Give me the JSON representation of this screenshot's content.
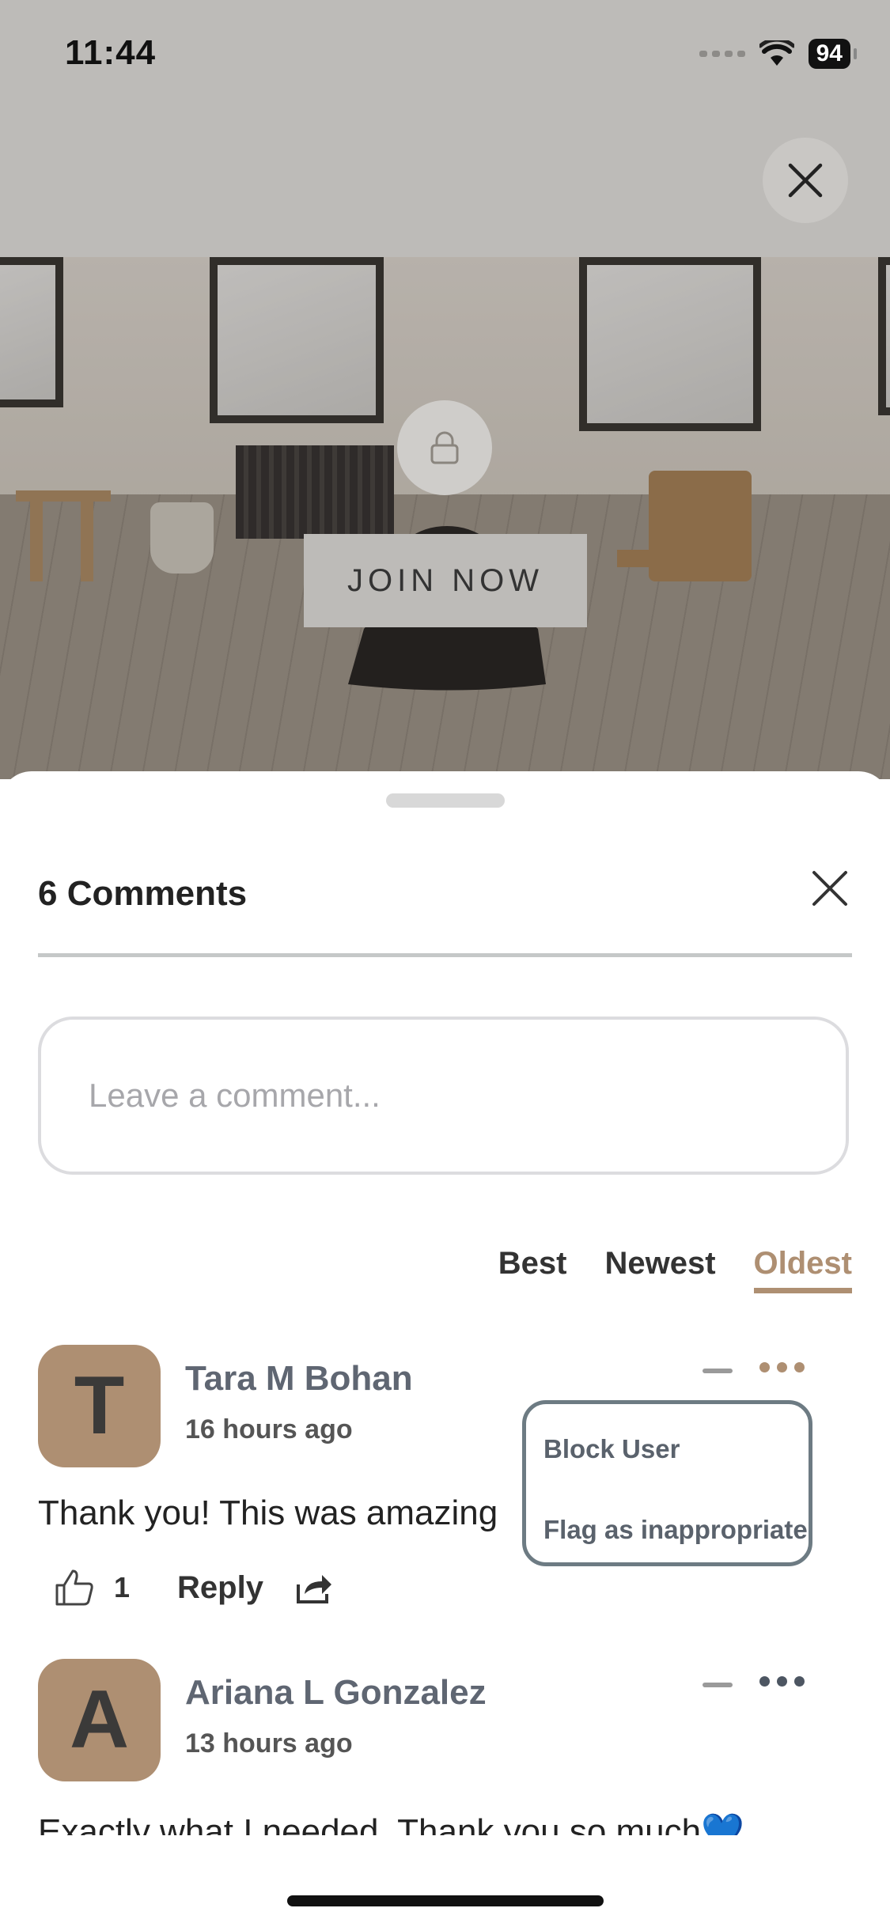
{
  "status_bar": {
    "time": "11:44",
    "battery": "94"
  },
  "video": {
    "join_label": "JOIN NOW"
  },
  "comments_sheet": {
    "title": "6 Comments",
    "input_placeholder": "Leave a comment...",
    "sort_tabs": [
      {
        "label": "Best",
        "active": false
      },
      {
        "label": "Newest",
        "active": false
      },
      {
        "label": "Oldest",
        "active": true
      }
    ],
    "comments": [
      {
        "initial": "T",
        "name": "Tara M Bohan",
        "time": "16 hours ago",
        "text": "Thank you! This was amazing",
        "likes": "1",
        "reply_label": "Reply",
        "more_icon_color": "#ae8f72"
      },
      {
        "initial": "A",
        "name": "Ariana L Gonzalez",
        "time": "13 hours ago",
        "text": "Exactly what I needed. Thank you so much💙",
        "more_icon_color": "#4d5662"
      }
    ],
    "menu": {
      "items": [
        "Block User",
        "Flag as inappropriate"
      ]
    }
  },
  "colors": {
    "accent": "#ae8f72",
    "menu_border": "#6d7b83",
    "name": "#5f6672"
  }
}
